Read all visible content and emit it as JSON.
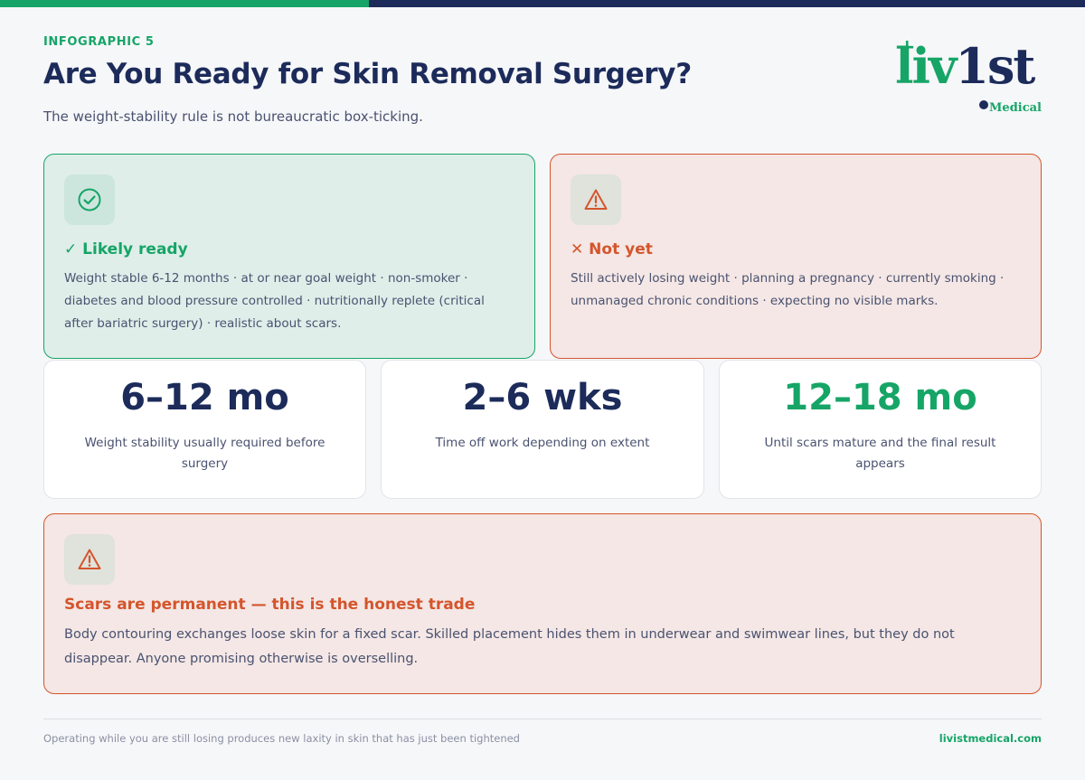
{
  "header": {
    "eyebrow": "INFOGRAPHIC 5",
    "title": "Are You Ready for Skin Removal Surgery?",
    "subtitle": "The weight-stability rule is not bureaucratic box-ticking."
  },
  "logo": {
    "word_green": "liv",
    "word_navy": "1st",
    "sub": "Medical"
  },
  "ready_card": {
    "icon": "check-circle-icon",
    "heading": "✓ Likely ready",
    "body": "Weight stable 6-12 months · at or near goal weight · non-smoker · diabetes and blood pressure controlled · nutritionally replete (critical after bariatric surgery) · realistic about scars."
  },
  "notyet_card": {
    "icon": "warning-triangle-icon",
    "heading": "✕ Not yet",
    "body": "Still actively losing weight · planning a pregnancy · currently smoking · unmanaged chronic conditions · expecting no visible marks."
  },
  "stats": [
    {
      "value": "6–12 mo",
      "label": "Weight stability usually required before surgery",
      "color": "#1c2b5a"
    },
    {
      "value": "2–6 wks",
      "label": "Time off work depending on extent",
      "color": "#1c2b5a"
    },
    {
      "value": "12–18 mo",
      "label": "Until scars mature and the final result appears",
      "color": "#16a567"
    }
  ],
  "scars_card": {
    "icon": "warning-triangle-icon",
    "heading": "Scars are permanent — this is the honest trade",
    "body": "Body contouring exchanges loose skin for a fixed scar. Skilled placement hides them in underwear and swimwear lines, but they do not disappear. Anyone promising otherwise is overselling."
  },
  "footer": {
    "note": "Operating while you are still losing produces new laxity in skin that has just been tightened",
    "site": "livistmedical.com"
  },
  "colors": {
    "brand_green": "#16a567",
    "brand_navy": "#1c2b5a",
    "warning_red": "#d4552c"
  }
}
